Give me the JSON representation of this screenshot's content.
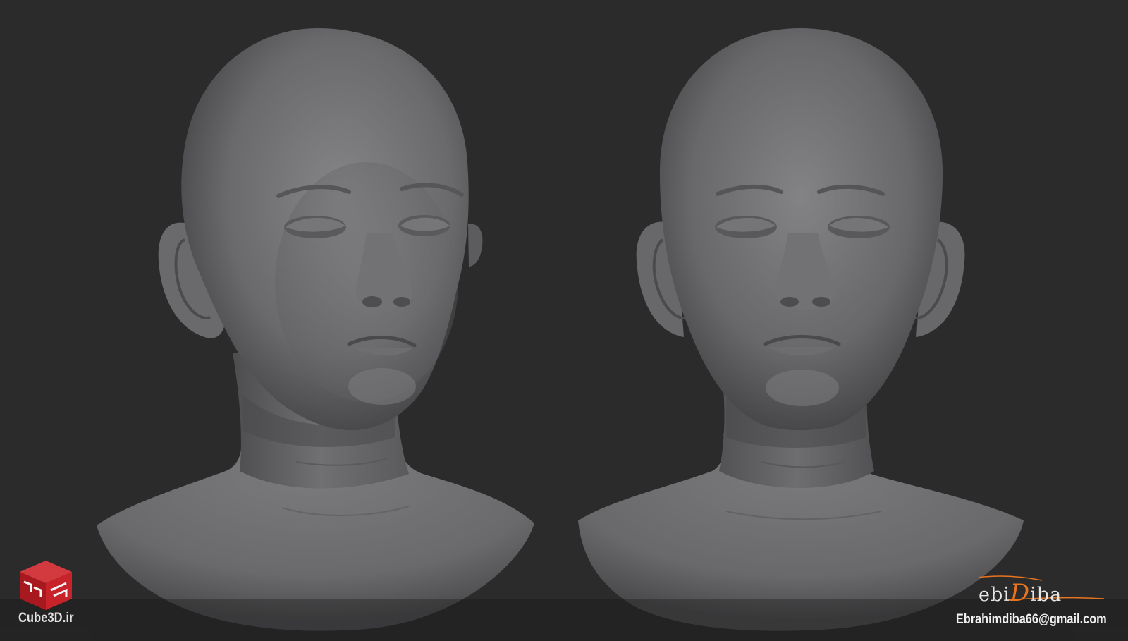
{
  "scene": {
    "subject": "Two renders of a sculpted bald child head bust, three-quarter and front views",
    "background_color": "#2b2b2c",
    "sculpt_color": "#6b6b6d"
  },
  "watermark_left": {
    "logo": "cube3d-logo",
    "text": "Cube3D.ir",
    "accent_color": "#c8232a"
  },
  "signature": {
    "name_part1": "ebi",
    "name_part2": "D",
    "name_part3": "iba",
    "accent_color": "#e8741f",
    "email": "Ebrahimdiba66@gmail.com"
  }
}
